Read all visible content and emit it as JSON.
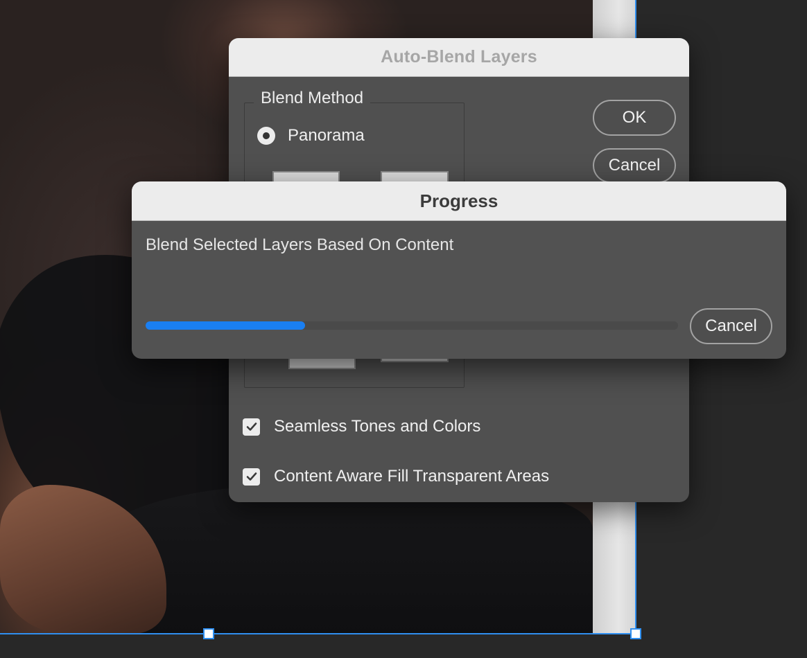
{
  "background": {
    "description_colors": {
      "selection": "#2f8ff0",
      "document_strip": "#e0e0e0"
    }
  },
  "auto_blend_dialog": {
    "title": "Auto-Blend Layers",
    "blend_method": {
      "legend": "Blend Method",
      "selected_option": "Panorama"
    },
    "ok_label": "OK",
    "cancel_label": "Cancel",
    "options": [
      {
        "label": "Seamless Tones and Colors",
        "checked": true,
        "check_glyph": "✔"
      },
      {
        "label": "Content Aware Fill Transparent Areas",
        "checked": true,
        "check_glyph": "✔"
      }
    ]
  },
  "progress_dialog": {
    "title": "Progress",
    "message": "Blend Selected Layers Based On Content",
    "progress_fraction": 0.3,
    "progress_color": "#1a7ff2",
    "cancel_label": "Cancel"
  }
}
